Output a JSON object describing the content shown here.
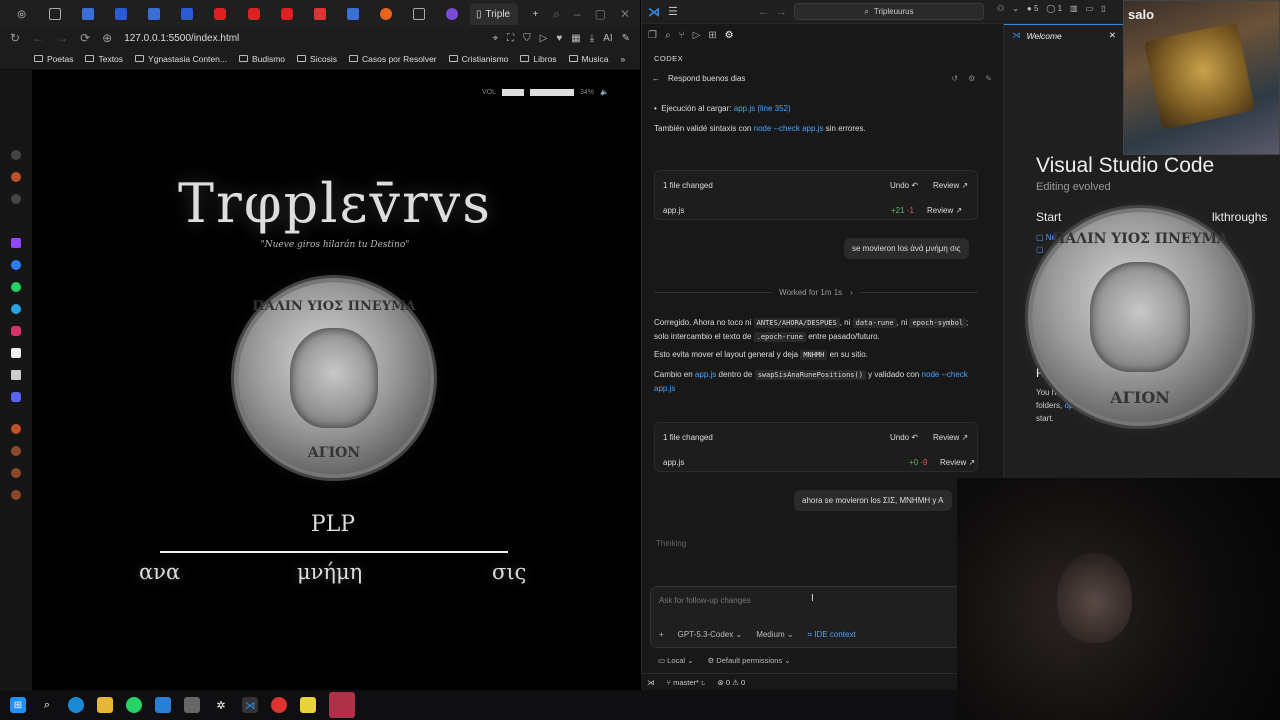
{
  "browser": {
    "tab_title": "Triple",
    "url": "127.0.0.1:5500/index.html",
    "ai_label": "AI",
    "bookmarks": [
      "Poetas",
      "Textos",
      "Ygnastasia Conten...",
      "Budismo",
      "Sicosis",
      "Casos por Resolver",
      "Cristianismo",
      "Libros",
      "Musica"
    ]
  },
  "page": {
    "volume_label": "VOL",
    "volume_pct": "34%",
    "title": "Trφplεv̄rvs",
    "subtitle": "\"Nueve giros hilarán tu Destino\"",
    "coin_top": "ΠΑΛΙΝ ΥΙΟΣ ΠΝΕΥΜΑ",
    "coin_bottom": "ΑΓΙΟΝ",
    "center_word": "PLP",
    "rune_left": "ανα",
    "rune_center": "μνήμη",
    "rune_right": "σις"
  },
  "editor": {
    "search": "Tripleuurus",
    "badge_dots": "5",
    "badge_circle": "1",
    "panel_label": "CODEX",
    "conversation_title": "Respond buenos dias",
    "bullet_text": "Ejecución al cargar:",
    "bullet_link": "app.js (line 352)",
    "syntax_pre": "También validé sintaxis con",
    "syntax_link": "node --check app.js",
    "syntax_post": "sin errores.",
    "card1": {
      "changed": "1 file changed",
      "undo": "Undo",
      "review": "Review",
      "file": "app.js",
      "add": "+21",
      "del": "-1"
    },
    "user_msg1": "se movieron los ἀνά μνήμη σις",
    "worked": "Worked for 1m 1s",
    "fix_p1_a": "Corregido. Ahora no toco ni",
    "fix_code1": "ANTES/AHORA/DESPUES",
    "fix_p1_b": ", ni",
    "fix_code2": "data-rune",
    "fix_p1_c": ", ni",
    "fix_code3": "epoch-symbol",
    "fix_p1_d": "; solo intercambio el texto de",
    "fix_code4": ".epoch-rune",
    "fix_p1_e": "entre pasado/futuro.",
    "fix_p2_a": "Esto evita mover el layout general y deja",
    "fix_code5": "MNHMH",
    "fix_p2_b": "en su sitio.",
    "fix_p3_a": "Cambio en",
    "fix_p3_link1": "app.js",
    "fix_p3_b": "dentro de",
    "fix_code6": "swapSisAnaRunePositions()",
    "fix_p3_c": "y validado con",
    "fix_p3_link2": "node --check app.js",
    "card2": {
      "changed": "1 file changed",
      "undo": "Undo",
      "review": "Review",
      "file": "app.js",
      "add": "+0",
      "del": "-9"
    },
    "user_msg2": "ahora se movieron los  ΣΙΣ, MNHMH y A",
    "thinking": "Thinking",
    "input_placeholder": "Ask for follow-up changes",
    "model": "GPT-5.3-Codex",
    "effort": "Medium",
    "ide_context": "IDE context",
    "local": "Local",
    "permissions": "Default permissions",
    "branch": "master*",
    "errors": "0",
    "warnings": "0"
  },
  "welcome": {
    "tab": "Welcome",
    "title": "Visual Studio Code",
    "subtitle": "Editing evolved",
    "start": "Start",
    "walkthroughs": "lkthroughs",
    "link1": "Ne",
    "recent": "Re",
    "recent_text_a": "You ha",
    "recent_text_b": "folders,",
    "recent_link": "open",
    "recent_text_c": "start.",
    "webcam_label": "salo"
  },
  "colors": {
    "accent": "#2f8ee0",
    "link": "#4aa3ff",
    "add": "#5fb95f",
    "del": "#e05555"
  }
}
